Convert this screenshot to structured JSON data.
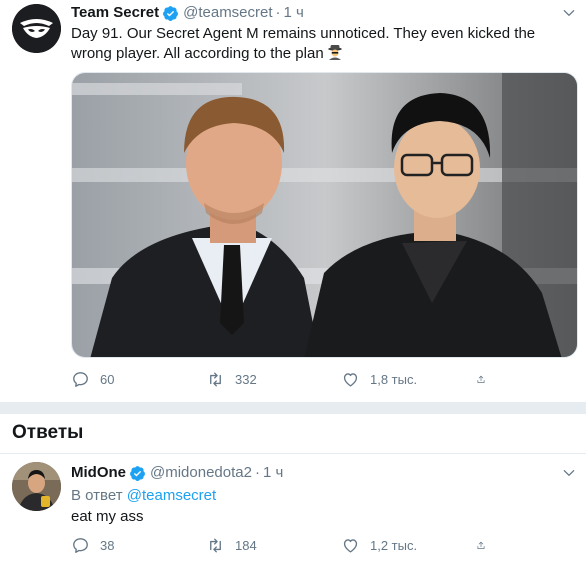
{
  "main_tweet": {
    "author": {
      "display_name": "Team Secret",
      "handle": "@teamsecret",
      "verified": true,
      "avatar_icon": "team-secret-logo-icon"
    },
    "separator": "·",
    "time": "1 ч",
    "text": "Day 91. Our Secret Agent M remains unnoticed. They even kicked the wrong player. All according to the plan",
    "emoji_icon": "spy-emoji-icon",
    "media": {
      "alt": "Two men in black jackets sitting side by side"
    },
    "actions": {
      "reply_count": "60",
      "retweet_count": "332",
      "like_count": "1,8 тыс."
    }
  },
  "replies_section": {
    "title": "Ответы"
  },
  "reply_tweet": {
    "author": {
      "display_name": "MidOne",
      "handle": "@midonedota2",
      "verified": true
    },
    "separator": "·",
    "time": "1 ч",
    "reply_prefix": "В ответ",
    "reply_mention": "@teamsecret",
    "text": "eat my ass",
    "actions": {
      "reply_count": "38",
      "retweet_count": "184",
      "like_count": "1,2 тыс."
    }
  },
  "colors": {
    "accent": "#1da1f2",
    "secondary_text": "#657786",
    "primary_text": "#14171a",
    "separator": "#e6ecf0"
  }
}
